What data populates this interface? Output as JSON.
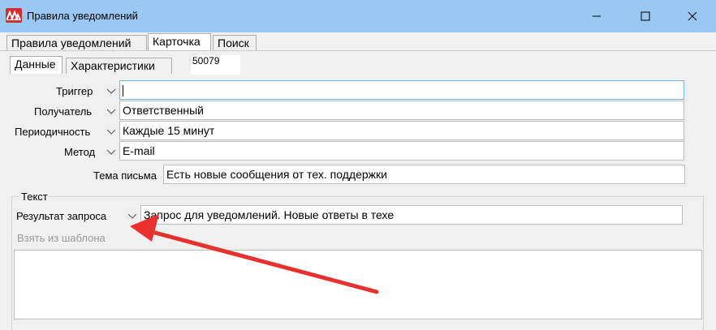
{
  "window": {
    "title": "Правила уведомлений"
  },
  "tabs": [
    {
      "label": "Правила уведомлений",
      "active": false
    },
    {
      "label": "Карточка",
      "active": true
    },
    {
      "label": "Поиск",
      "active": false
    }
  ],
  "subtabs": [
    {
      "label": "Данные",
      "active": true
    },
    {
      "label": "Характеристики",
      "active": false
    }
  ],
  "record_id": "50079",
  "form": {
    "trigger": {
      "label": "Триггер",
      "value": ""
    },
    "recipient": {
      "label": "Получатель",
      "value": "Ответственный"
    },
    "periodicity": {
      "label": "Периодичность",
      "value": "Каждые 15 минут"
    },
    "method": {
      "label": "Метод",
      "value": "E-mail"
    },
    "subject": {
      "label": "Тема письма",
      "value": "Есть новые сообщения от тех. поддержки"
    }
  },
  "text_group": {
    "title": "Текст",
    "query_result": {
      "label": "Результат запроса",
      "value": "Запрос для уведомлений. Новые ответы в техе"
    },
    "template_link": "Взять из шаблона",
    "body": ""
  },
  "colors": {
    "titlebar": "#99c9f2",
    "arrow": "#e8312f"
  }
}
